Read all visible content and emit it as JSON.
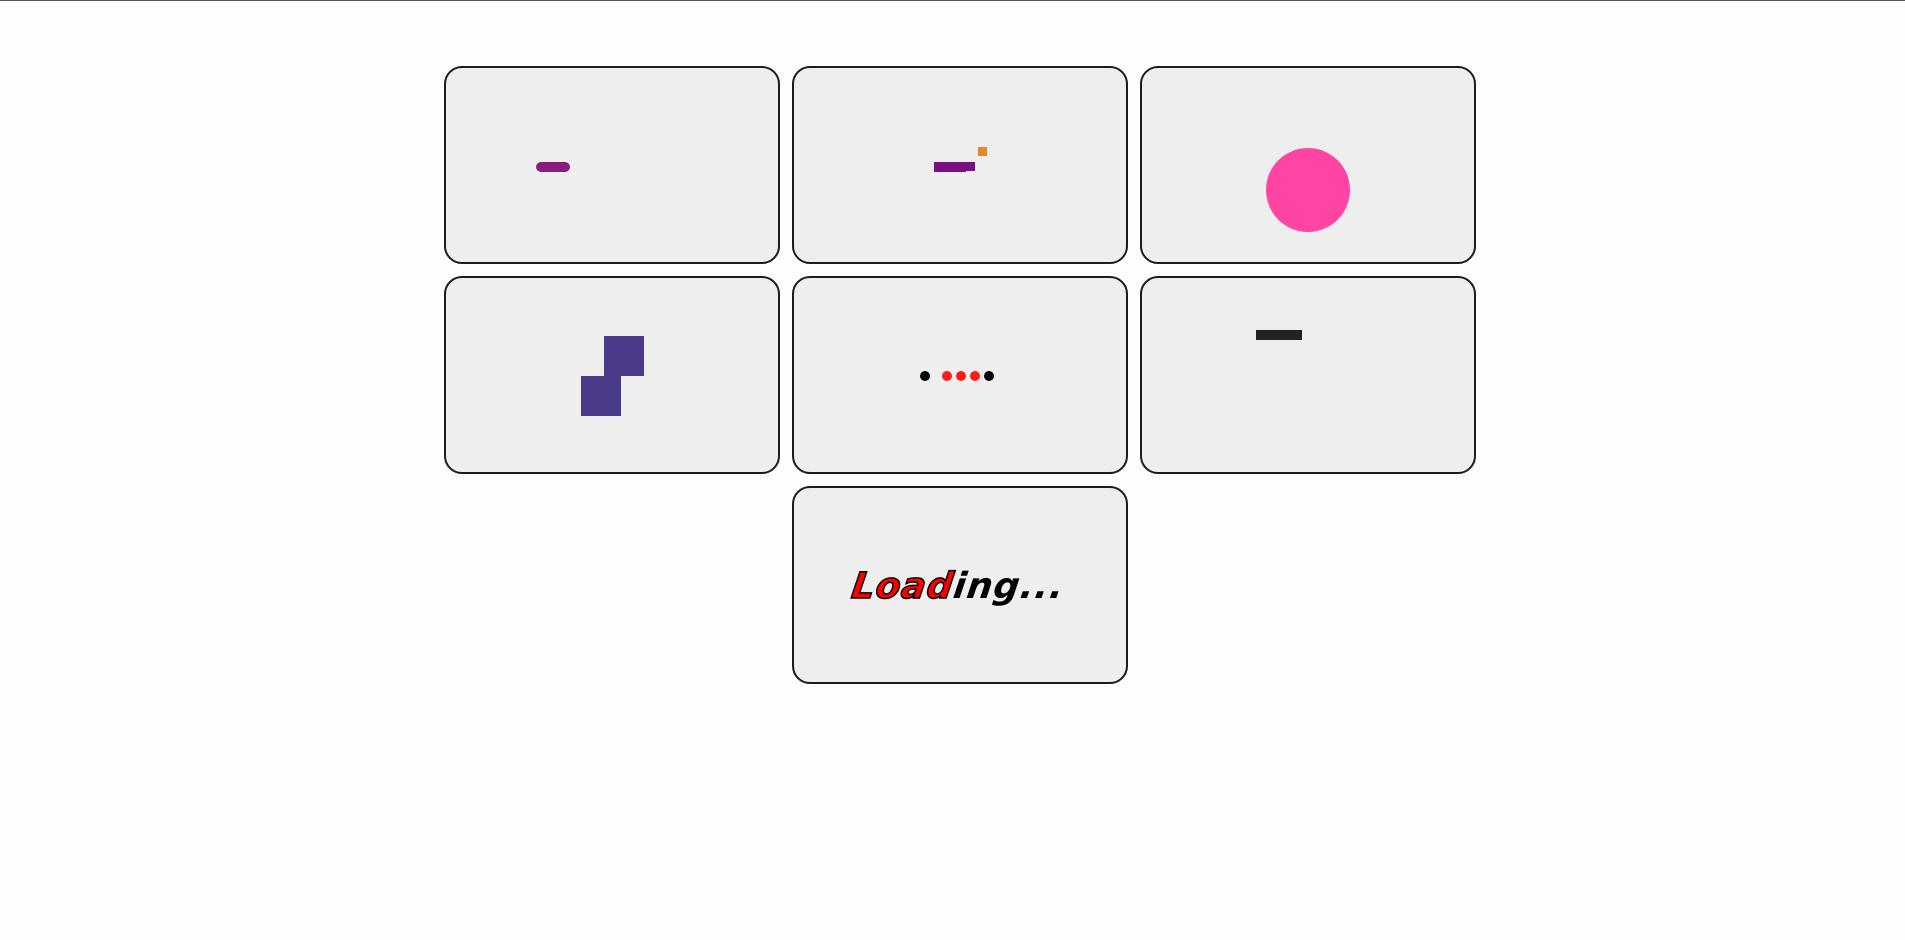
{
  "loaders": {
    "text": {
      "red_part": "Load",
      "black_part": "ing..."
    }
  },
  "colors": {
    "pill": "#8a1c7c",
    "bar": "#7a0f82",
    "orange_square": "#e8842c",
    "pink_circle": "#ff45a4",
    "blocks": "#4b3a8a",
    "dot_black": "#000000",
    "dot_red": "#ff1a1a",
    "dash": "#222222",
    "card_bg": "#eeeeef",
    "card_border": "#1c1c1c"
  }
}
